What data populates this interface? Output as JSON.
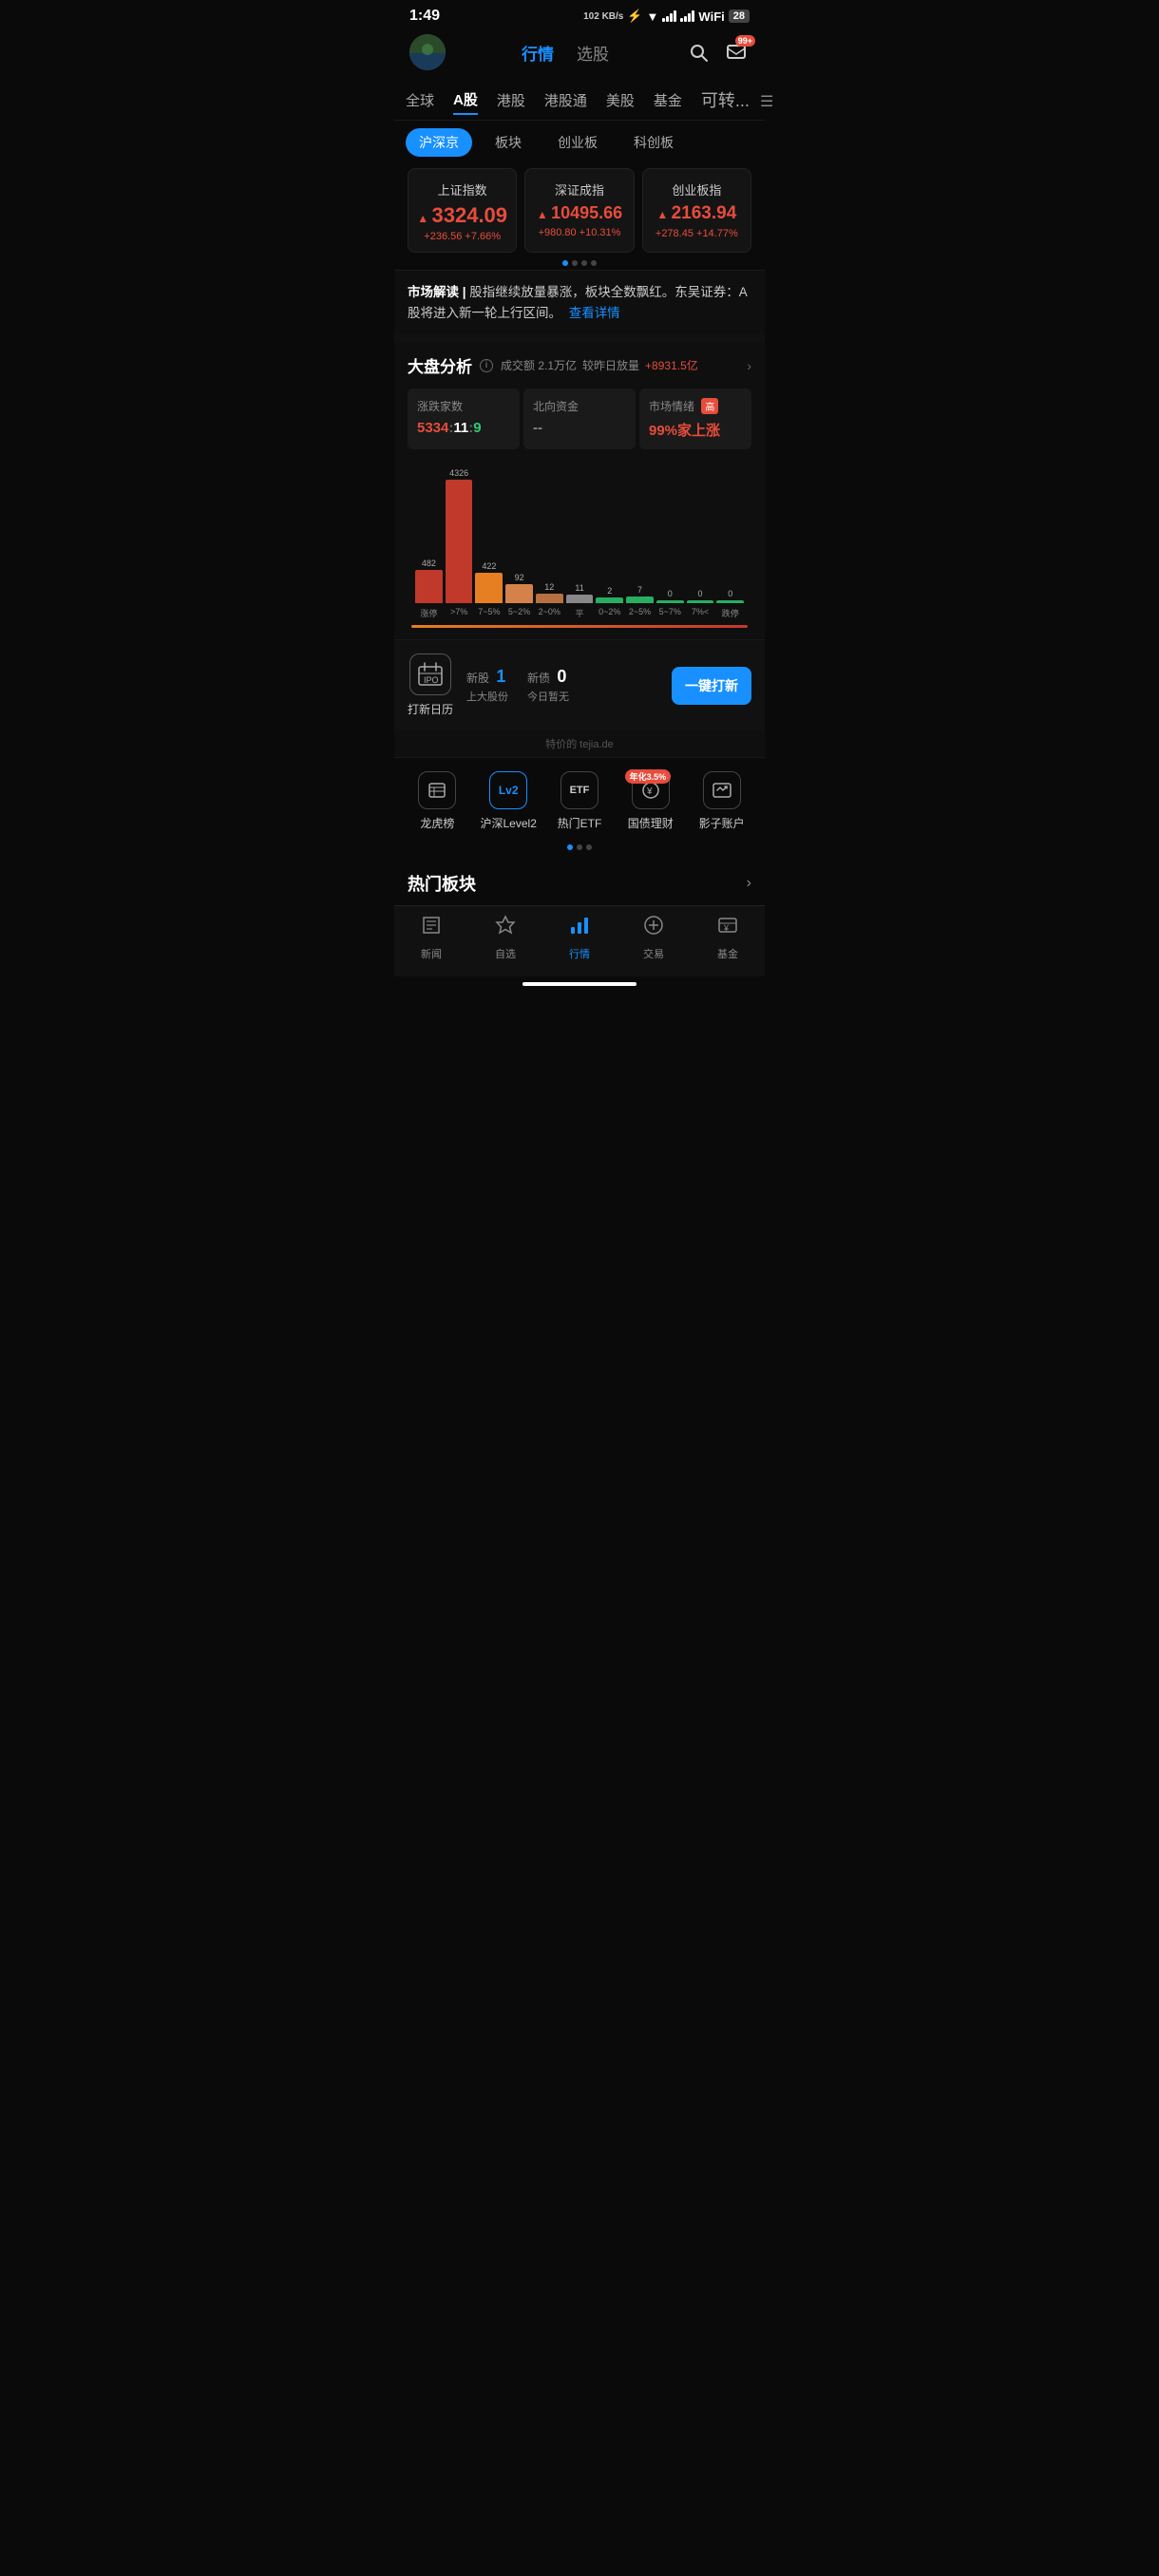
{
  "statusBar": {
    "time": "1:49",
    "network": "102 KB/s",
    "battery": "28"
  },
  "header": {
    "navItems": [
      {
        "label": "行情",
        "active": true
      },
      {
        "label": "选股",
        "active": false
      }
    ],
    "searchLabel": "搜索",
    "messageLabel": "消息",
    "messageBadge": "99+"
  },
  "tabs": [
    {
      "label": "全球",
      "active": false
    },
    {
      "label": "A股",
      "active": true
    },
    {
      "label": "港股",
      "active": false
    },
    {
      "label": "港股通",
      "active": false
    },
    {
      "label": "美股",
      "active": false
    },
    {
      "label": "基金",
      "active": false
    },
    {
      "label": "可转...",
      "active": false
    }
  ],
  "subTabs": [
    {
      "label": "沪深京",
      "active": true
    },
    {
      "label": "板块",
      "active": false
    },
    {
      "label": "创业板",
      "active": false
    },
    {
      "label": "科创板",
      "active": false
    }
  ],
  "indices": [
    {
      "name": "上证指数",
      "value": "3324.09",
      "change": "+236.56 +7.66%"
    },
    {
      "name": "深证成指",
      "value": "10495.66",
      "change": "+980.80 +10.31%"
    },
    {
      "name": "创业板指",
      "value": "2163.94",
      "change": "+278.45 +14.77%"
    }
  ],
  "marketReading": {
    "prefix": "市场解读",
    "text": "股指继续放量暴涨，板块全数飘红。东吴证券：A股将进入新一轮上行区间。",
    "linkText": "查看详情"
  },
  "boardAnalysis": {
    "title": "大盘分析",
    "volume": "成交额 2.1万亿",
    "volumeChange": "+8931.5亿",
    "changeLabel": "较昨日放量",
    "stats": [
      {
        "label": "涨跌家数",
        "valueRed": "5334",
        "sep": ":",
        "valueMid": "11",
        "sep2": ":",
        "valueGreen": "9"
      },
      {
        "label": "北向资金",
        "value": "--"
      },
      {
        "label": "市场情绪",
        "badge": "高",
        "subValue": "99%家上涨"
      }
    ],
    "bars": [
      {
        "label": "涨停",
        "value": "482",
        "height": 35,
        "color": "red"
      },
      {
        "label": ">7%",
        "value": "4326",
        "height": 140,
        "color": "dark-red"
      },
      {
        "label": "7~5%",
        "value": "422",
        "height": 32,
        "color": "orange"
      },
      {
        "label": "5~2%",
        "value": "92",
        "height": 20,
        "color": "light-orange"
      },
      {
        "label": "2~0%",
        "value": "12",
        "height": 10,
        "color": "light-orange"
      },
      {
        "label": "平",
        "value": "11",
        "height": 9,
        "color": "gray"
      },
      {
        "label": "0~2%",
        "value": "2",
        "height": 6,
        "color": "green"
      },
      {
        "label": "2~5%",
        "value": "7",
        "height": 7,
        "color": "green"
      },
      {
        "label": "5~7%",
        "value": "0",
        "height": 2,
        "color": "green"
      },
      {
        "label": "7%<",
        "value": "0",
        "height": 2,
        "color": "green"
      },
      {
        "label": "跌停",
        "value": "0",
        "height": 2,
        "color": "green"
      }
    ]
  },
  "ipoSection": {
    "iconLabel": "IPO",
    "title": "打新日历",
    "newStockLabel": "新股",
    "newStockCount": "1",
    "newStockSub": "上大股份",
    "newDebtLabel": "新债",
    "newDebtCount": "0",
    "newDebtSub": "今日暂无",
    "buttonLabel": "一键打新"
  },
  "tools": [
    {
      "icon": "≡",
      "label": "龙虎榜"
    },
    {
      "icon": "Lv2",
      "label": "沪深Level2"
    },
    {
      "icon": "ETF",
      "label": "热门ETF"
    },
    {
      "icon": "¥",
      "label": "国债理财",
      "badge": "年化3.5%"
    },
    {
      "icon": "↗",
      "label": "影子账户"
    }
  ],
  "hotSection": {
    "title": "热门板块",
    "more": ">"
  },
  "bottomNav": [
    {
      "icon": "↑",
      "label": "新闻",
      "active": false
    },
    {
      "icon": "☆",
      "label": "自选",
      "active": false
    },
    {
      "icon": "📊",
      "label": "行情",
      "active": true
    },
    {
      "icon": "⊙",
      "label": "交易",
      "active": false
    },
    {
      "icon": "¥",
      "label": "基金",
      "active": false
    }
  ]
}
